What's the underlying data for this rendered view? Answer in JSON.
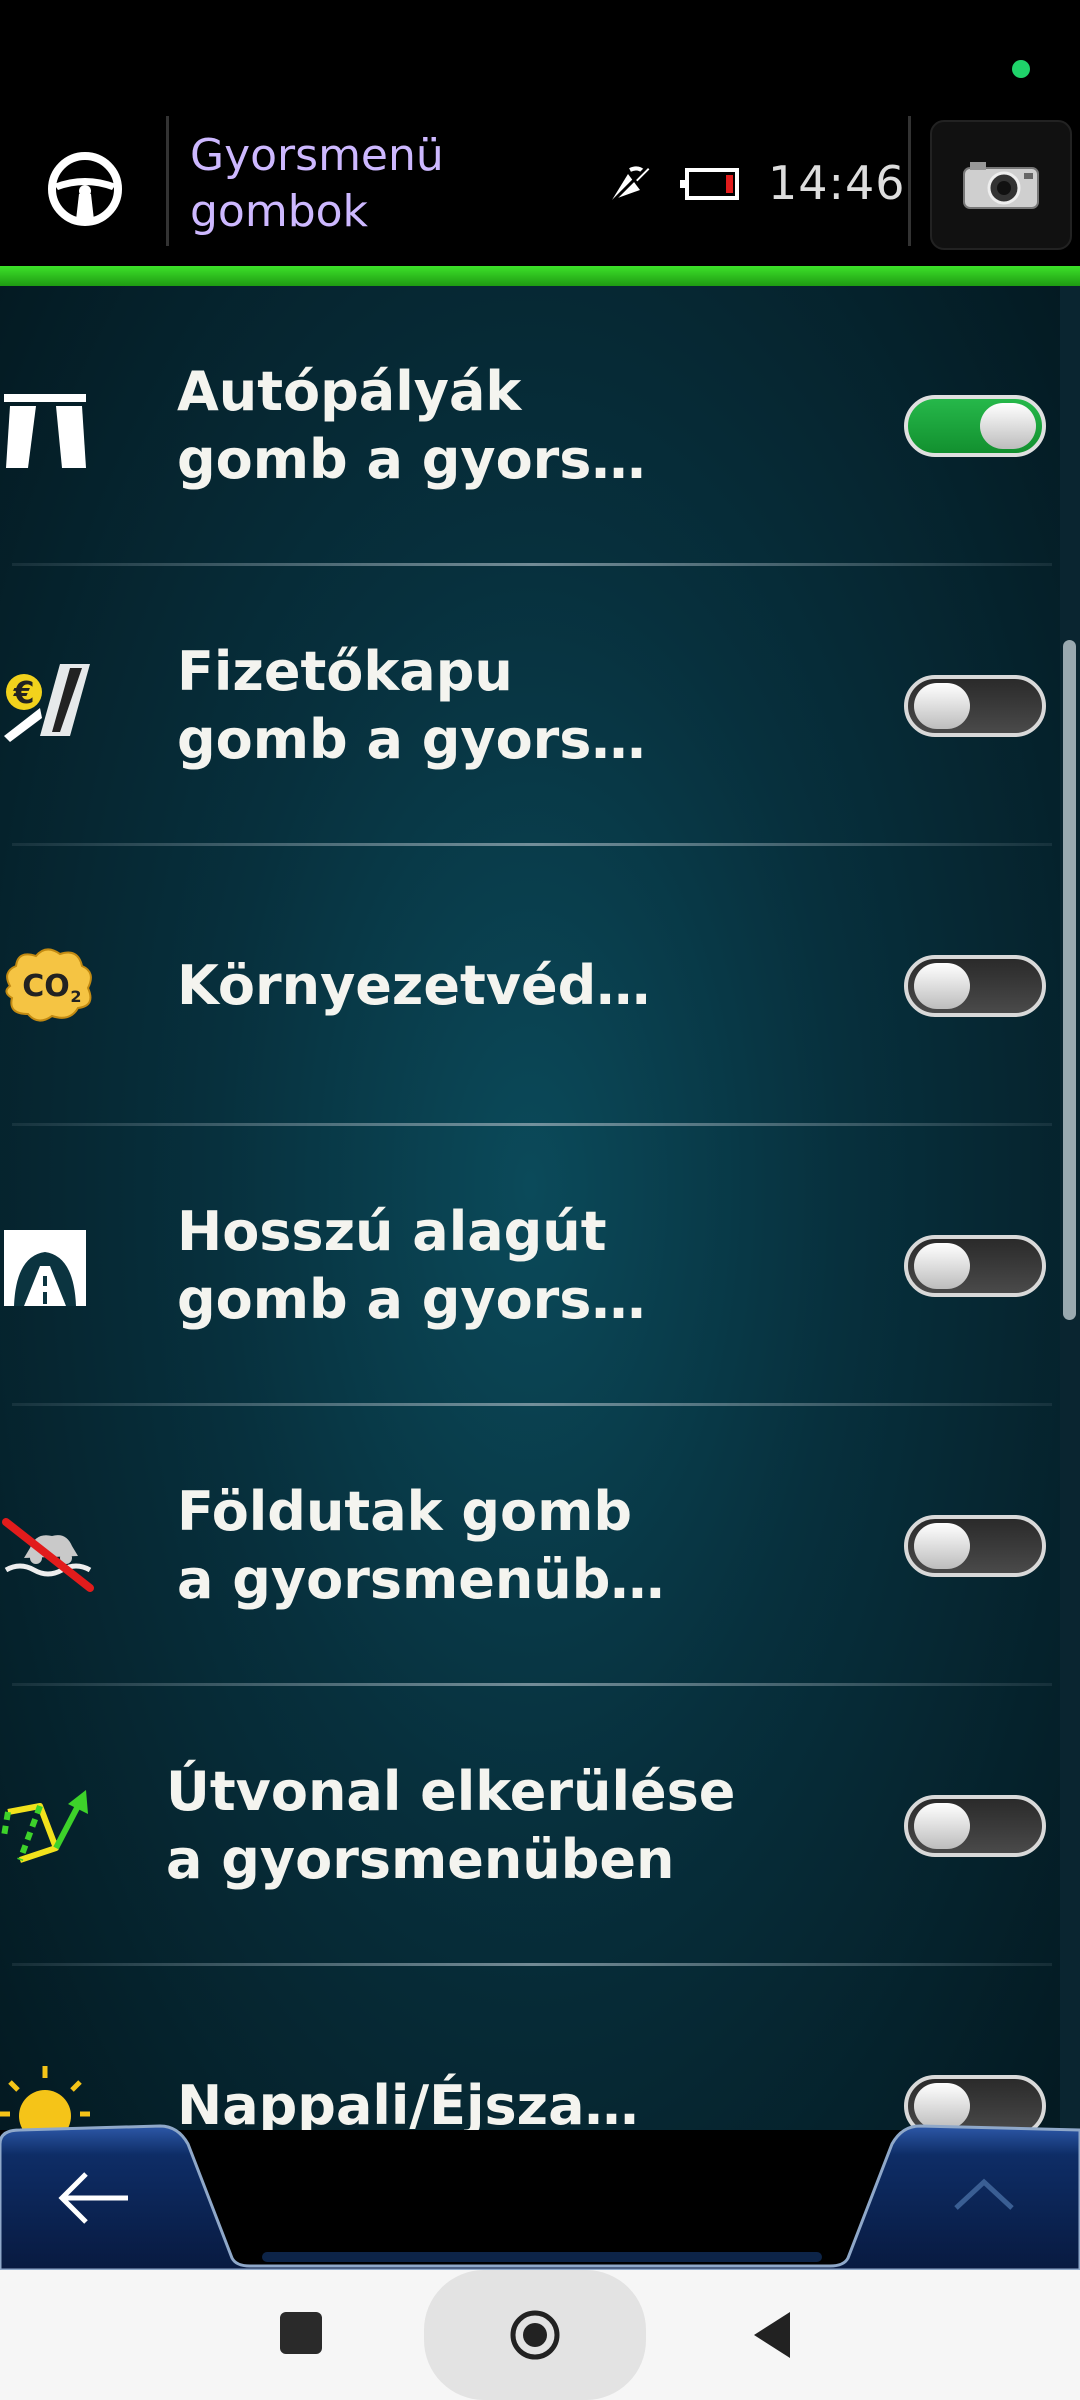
{
  "header": {
    "title": "Gyorsmenü\ngombok",
    "time": "14:46",
    "status_dot_color": "#1fd36a",
    "accent_bar_color": "#3de22a",
    "icons": [
      "steering-wheel-icon",
      "gps-off-icon",
      "battery-low-icon",
      "camera-icon"
    ]
  },
  "list": {
    "items": [
      {
        "label": "Autópályák\ngomb a gyors…",
        "icon": "highway-icon",
        "enabled": true
      },
      {
        "label": "Fizetőkapu\ngomb a gyors…",
        "icon": "toll-road-icon",
        "enabled": false
      },
      {
        "label": "Környezetvéd…",
        "icon": "co2-icon",
        "enabled": false
      },
      {
        "label": "Hosszú alagút\ngomb a gyors…",
        "icon": "tunnel-icon",
        "enabled": false
      },
      {
        "label": "Földutak gomb\na gyorsmenüb…",
        "icon": "unpaved-road-off-icon",
        "enabled": false
      },
      {
        "label": "Útvonal elkerülése\na gyorsmenüben",
        "icon": "route-avoid-icon",
        "enabled": false
      },
      {
        "label": "Nappali/Éjsza…",
        "icon": "day-night-auto-icon",
        "enabled": false
      }
    ],
    "toggle_on_color": "#26b84a"
  },
  "bottom_bar": {
    "back_icon": "arrow-left-icon",
    "up_icon": "chevron-up-icon"
  },
  "system_nav": {
    "icons": [
      "recents-icon",
      "home-icon",
      "back-triangle-icon"
    ]
  }
}
